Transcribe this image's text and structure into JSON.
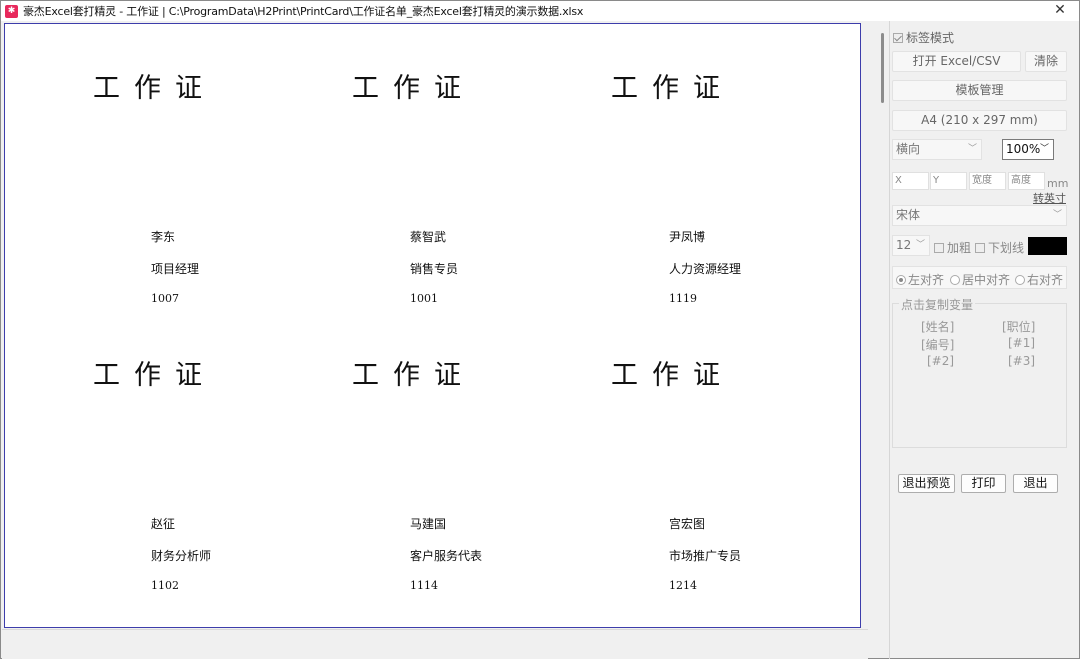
{
  "window": {
    "app_icon": "app-logo-icon",
    "title": "豪杰Excel套打精灵 - 工作证 | C:\\ProgramData\\H2Print\\PrintCard\\工作证名单_豪杰Excel套打精灵的演示数据.xlsx",
    "close_glyph": "✕"
  },
  "cards": [
    {
      "title": "工作证",
      "name": "李东",
      "position": "项目经理",
      "id": "1007"
    },
    {
      "title": "工作证",
      "name": "蔡智武",
      "position": "销售专员",
      "id": "1001"
    },
    {
      "title": "工作证",
      "name": "尹凤博",
      "position": "人力资源经理",
      "id": "1119"
    },
    {
      "title": "工作证",
      "name": "赵征",
      "position": "财务分析师",
      "id": "1102"
    },
    {
      "title": "工作证",
      "name": "马建国",
      "position": "客户服务代表",
      "id": "1114"
    },
    {
      "title": "工作证",
      "name": "宫宏图",
      "position": "市场推广专员",
      "id": "1214"
    }
  ],
  "panel": {
    "label_mode": "标签模式",
    "label_mode_checked": true,
    "open_excel": "打开 Excel/CSV",
    "clear": "清除",
    "template_manage": "模板管理",
    "paper_size": "A4 (210 x 297 mm)",
    "orientation": "横向",
    "zoom": "100%",
    "pos_x_placeholder": "X",
    "pos_y_placeholder": "Y",
    "width_placeholder": "宽度",
    "height_placeholder": "高度",
    "unit": "mm",
    "convert_inch": "转英寸",
    "font": "宋体",
    "font_size": "12",
    "bold": "加粗",
    "underline": "下划线",
    "text_color": "#000000",
    "align_left": "左对齐",
    "align_center": "居中对齐",
    "align_right": "右对齐",
    "variables_legend": "点击复制变量",
    "variables": [
      "[姓名]",
      "[职位]",
      "[编号]",
      "[#1]",
      "[#2]",
      "[#3]"
    ],
    "exit_preview": "退出预览",
    "print": "打印",
    "exit": "退出"
  },
  "colors": {
    "page_border": "#3d3dab",
    "app_icon": "#e8285c"
  }
}
